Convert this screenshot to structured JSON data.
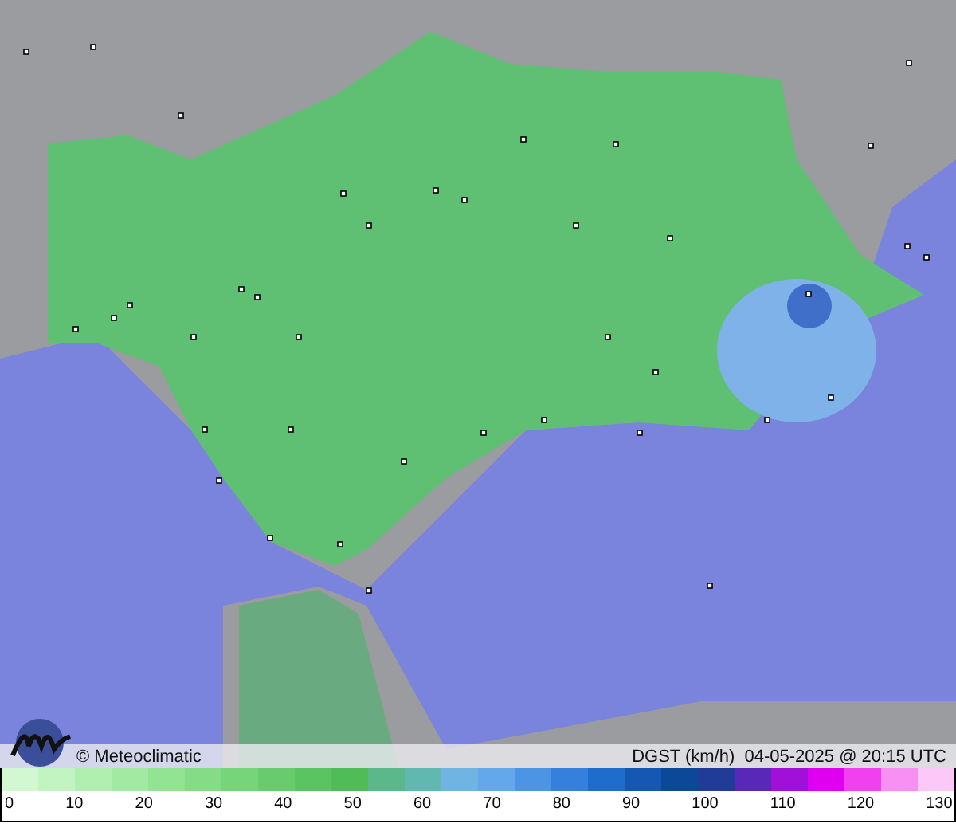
{
  "map": {
    "credit": "© Meteoclimatic",
    "caption": "DGST (km/h)  04-05-2025 @ 20:15 UTC"
  },
  "legend": {
    "swatches": [
      {
        "color": "#d2f8d2"
      },
      {
        "color": "#c2f4c2"
      },
      {
        "color": "#b0efb0"
      },
      {
        "color": "#a2eaa2"
      },
      {
        "color": "#92e392"
      },
      {
        "color": "#84dc86"
      },
      {
        "color": "#76d47a"
      },
      {
        "color": "#68cc6e"
      },
      {
        "color": "#5ac462"
      },
      {
        "color": "#50bc58"
      },
      {
        "color": "#5ab88a"
      },
      {
        "color": "#60b8b0"
      },
      {
        "color": "#70b4e4"
      },
      {
        "color": "#64a8ec"
      },
      {
        "color": "#4c94e4"
      },
      {
        "color": "#3480dc"
      },
      {
        "color": "#1e6ccc"
      },
      {
        "color": "#1458b4"
      },
      {
        "color": "#0c4898"
      },
      {
        "color": "#203c98"
      },
      {
        "color": "#5a28b8"
      },
      {
        "color": "#a010d8"
      },
      {
        "color": "#e000f0"
      },
      {
        "color": "#f040f0"
      },
      {
        "color": "#f890f4"
      },
      {
        "color": "#fcc8f8"
      }
    ],
    "ticks": [
      "0",
      "10",
      "20",
      "30",
      "40",
      "50",
      "60",
      "70",
      "80",
      "90",
      "100",
      "110",
      "120",
      "130"
    ]
  }
}
